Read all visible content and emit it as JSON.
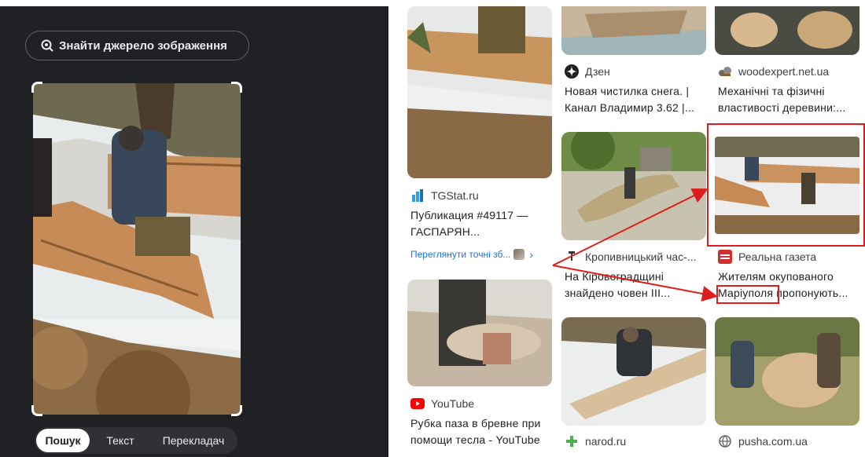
{
  "left_panel": {
    "find_source_label": "Знайти джерело зображення",
    "modes": [
      "Пошук",
      "Текст",
      "Перекладач"
    ],
    "active_mode": "Пошук"
  },
  "results": [
    {
      "source": "TGStat.ru",
      "title": "Публикация #49117 —\nГАСПАРЯН...",
      "extra_link": "Переглянути точні зб..."
    },
    {
      "source": "YouTube",
      "title": "Рубка паза в бревне при\nпомощи тесла - YouTube"
    },
    {
      "source": "Дзен",
      "title": "Новая чистилка снега. |\nКанал Владимир 3.62 |..."
    },
    {
      "source": "Кропивницький час-...",
      "title": "На Кіровоградщині\nзнайдено човен ІІІ..."
    },
    {
      "source": "narod.ru",
      "title": ""
    },
    {
      "source": "woodexpert.net.ua",
      "title": "Механічні та фізичні\nвластивості деревини:..."
    },
    {
      "source": "Реальна газета",
      "title": "Жителям окупованого\nМаріуполя пропонують..."
    },
    {
      "source": "pusha.com.ua",
      "title": ""
    }
  ],
  "colors": {
    "highlight": "#e01b1b",
    "link": "#1a73e8",
    "panel_bg": "#202124"
  }
}
